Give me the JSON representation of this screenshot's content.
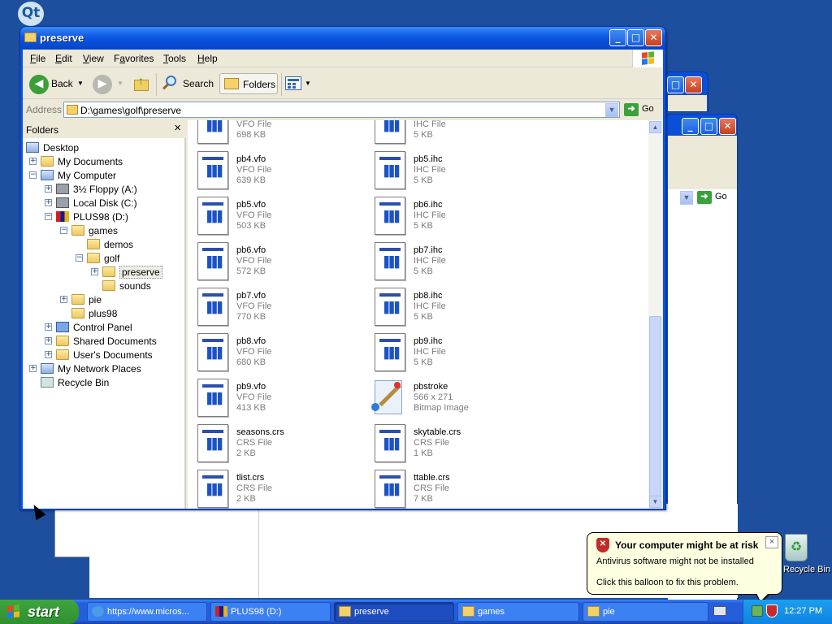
{
  "desktop": {
    "qt_icon_label": "Qt",
    "recycle_bin_label": "Recycle Bin"
  },
  "window": {
    "title": "preserve",
    "menu": [
      "File",
      "Edit",
      "View",
      "Favorites",
      "Tools",
      "Help"
    ],
    "menu_access": [
      "F",
      "E",
      "V",
      "a",
      "T",
      "H"
    ],
    "toolbar": {
      "back": "Back",
      "search": "Search",
      "folders": "Folders"
    },
    "address": {
      "label": "Address",
      "value": "D:\\games\\golf\\preserve",
      "go": "Go"
    }
  },
  "folders_pane": {
    "title": "Folders",
    "close": "×",
    "nodes": [
      {
        "label": "Desktop",
        "icon": "desktop-icon"
      },
      {
        "label": "My Documents",
        "icon": "documents-icon",
        "toggle": "+"
      },
      {
        "label": "My Computer",
        "icon": "computer-icon",
        "toggle": "−"
      },
      {
        "label": "3½ Floppy (A:)",
        "icon": "floppy-icon",
        "toggle": "+"
      },
      {
        "label": "Local Disk (C:)",
        "icon": "disk-icon",
        "toggle": "+"
      },
      {
        "label": "PLUS98 (D:)",
        "icon": "cdrom-icon",
        "toggle": "−"
      },
      {
        "label": "games",
        "icon": "folder-icon",
        "toggle": "−"
      },
      {
        "label": "demos",
        "icon": "folder-icon"
      },
      {
        "label": "golf",
        "icon": "folder-icon",
        "toggle": "−"
      },
      {
        "label": "preserve",
        "icon": "folder-open-icon",
        "toggle": "+",
        "selected": true
      },
      {
        "label": "sounds",
        "icon": "folder-icon"
      },
      {
        "label": "pie",
        "icon": "folder-icon",
        "toggle": "+"
      },
      {
        "label": "plus98",
        "icon": "folder-icon"
      },
      {
        "label": "Control Panel",
        "icon": "control-panel-icon",
        "toggle": "+"
      },
      {
        "label": "Shared Documents",
        "icon": "folder-icon",
        "toggle": "+"
      },
      {
        "label": "User's Documents",
        "icon": "folder-icon",
        "toggle": "+"
      },
      {
        "label": "My Network Places",
        "icon": "network-icon",
        "toggle": "+"
      },
      {
        "label": "Recycle Bin",
        "icon": "recycle-bin-icon"
      }
    ]
  },
  "files": [
    {
      "name": "",
      "type": "VFO File",
      "size": "698 KB"
    },
    {
      "name": "",
      "type": "IHC File",
      "size": "5 KB"
    },
    {
      "name": "pb4.vfo",
      "type": "VFO File",
      "size": "639 KB"
    },
    {
      "name": "pb5.ihc",
      "type": "IHC File",
      "size": "5 KB"
    },
    {
      "name": "pb5.vfo",
      "type": "VFO File",
      "size": "503 KB"
    },
    {
      "name": "pb6.ihc",
      "type": "IHC File",
      "size": "5 KB"
    },
    {
      "name": "pb6.vfo",
      "type": "VFO File",
      "size": "572 KB"
    },
    {
      "name": "pb7.ihc",
      "type": "IHC File",
      "size": "5 KB"
    },
    {
      "name": "pb7.vfo",
      "type": "VFO File",
      "size": "770 KB"
    },
    {
      "name": "pb8.ihc",
      "type": "IHC File",
      "size": "5 KB"
    },
    {
      "name": "pb8.vfo",
      "type": "VFO File",
      "size": "680 KB"
    },
    {
      "name": "pb9.ihc",
      "type": "IHC File",
      "size": "5 KB"
    },
    {
      "name": "pb9.vfo",
      "type": "VFO File",
      "size": "413 KB"
    },
    {
      "name": "pbstroke",
      "type": "566 x 271",
      "size": "Bitmap Image",
      "icon": "bitmap-icon"
    },
    {
      "name": "seasons.crs",
      "type": "CRS File",
      "size": "2 KB"
    },
    {
      "name": "skytable.crs",
      "type": "CRS File",
      "size": "1 KB"
    },
    {
      "name": "tlist.crs",
      "type": "CRS File",
      "size": "2 KB"
    },
    {
      "name": "ttable.crs",
      "type": "CRS File",
      "size": "7 KB"
    }
  ],
  "balloon": {
    "title": "Your computer might be at risk",
    "line1": "Antivirus software might not be installed",
    "line2": "Click this balloon to fix this problem.",
    "close": "×"
  },
  "taskbar": {
    "start": "start",
    "tasks": [
      {
        "label": "https://www.micros...",
        "icon": "ie-icon"
      },
      {
        "label": "PLUS98 (D:)",
        "icon": "cdrom-icon"
      },
      {
        "label": "preserve",
        "icon": "folder-icon",
        "active": true
      },
      {
        "label": "games",
        "icon": "folder-icon"
      },
      {
        "label": "pie",
        "icon": "folder-icon"
      }
    ],
    "clock": "12:27 PM"
  },
  "colors": {
    "taskbar_blue": "#245edb",
    "title_blue": "#0a57e4",
    "start_green": "#3ea63e",
    "balloon_bg": "#ffffe1"
  }
}
